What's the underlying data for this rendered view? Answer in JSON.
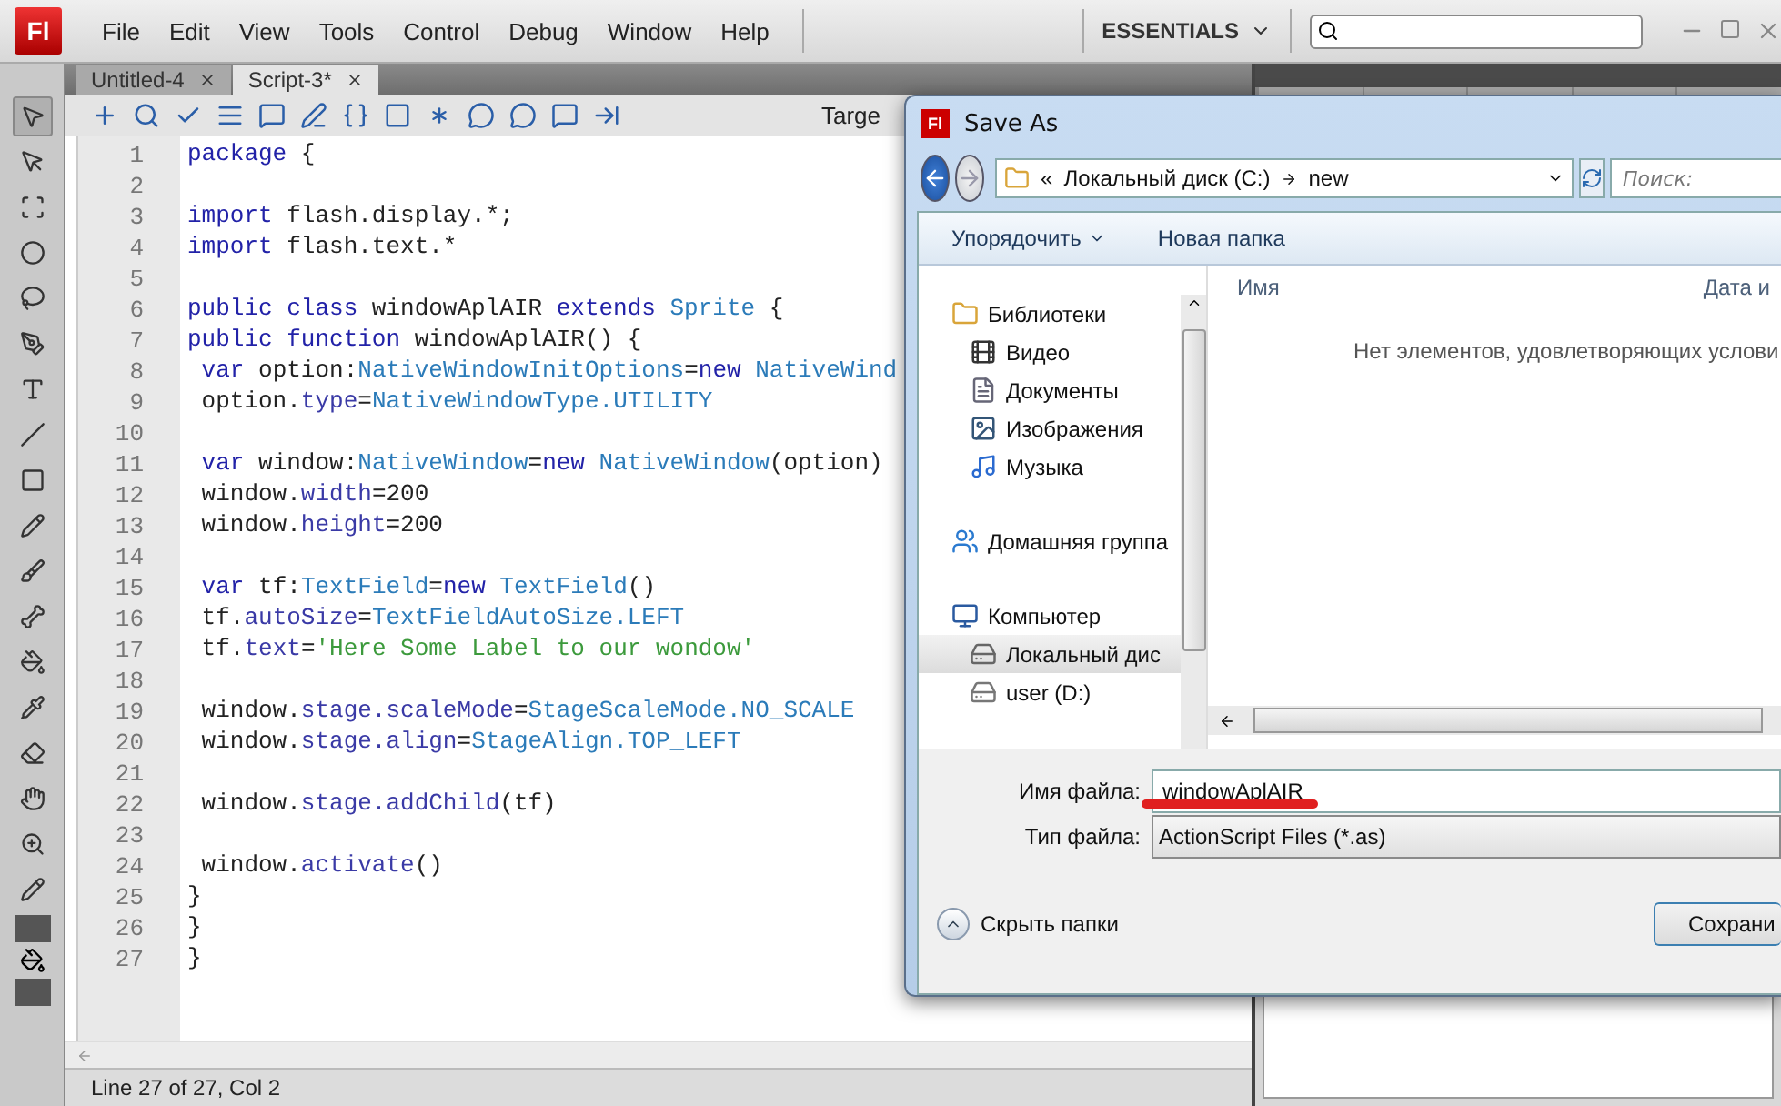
{
  "app": {
    "logo": "Fl",
    "menu": [
      "File",
      "Edit",
      "View",
      "Tools",
      "Control",
      "Debug",
      "Window",
      "Help"
    ],
    "workspace": "ESSENTIALS"
  },
  "tabs": [
    {
      "label": "Untitled-4",
      "selected": false
    },
    {
      "label": "Script-3*",
      "selected": true
    }
  ],
  "editor": {
    "target_label": "Targe",
    "lines": [
      {
        "number": "1",
        "tokens": [
          {
            "t": "package",
            "kind": "keyword"
          },
          {
            "t": " {",
            "kind": "plain"
          }
        ]
      },
      {
        "number": "2"
      },
      {
        "number": "3",
        "tokens": [
          {
            "t": "import",
            "kind": "keyword"
          },
          {
            "t": " flash.display.*;",
            "kind": "plain"
          }
        ]
      },
      {
        "number": "4",
        "tokens": [
          {
            "t": "import",
            "kind": "keyword"
          },
          {
            "t": " flash.text.*",
            "kind": "plain"
          }
        ]
      },
      {
        "number": "5"
      },
      {
        "number": "6",
        "tokens": [
          {
            "t": "public class",
            "kind": "keyword"
          },
          {
            "t": " windowAplAIR ",
            "kind": "plain"
          },
          {
            "t": "extends",
            "kind": "keyword"
          },
          {
            "t": " Sprite",
            "kind": "type"
          },
          {
            "t": " {",
            "kind": "plain"
          }
        ]
      },
      {
        "number": "7",
        "tokens": [
          {
            "t": "public function",
            "kind": "keyword"
          },
          {
            "t": " windowAplAIR() {",
            "kind": "plain"
          }
        ]
      },
      {
        "number": "8",
        "tokens": [
          {
            "t": " var",
            "kind": "keyword"
          },
          {
            "t": " option:",
            "kind": "plain"
          },
          {
            "t": "NativeWindowInitOptions",
            "kind": "type"
          },
          {
            "t": "=",
            "kind": "plain"
          },
          {
            "t": "new",
            "kind": "keyword"
          },
          {
            "t": " NativeWind",
            "kind": "type"
          }
        ]
      },
      {
        "number": "9",
        "tokens": [
          {
            "t": " option.",
            "kind": "plain"
          },
          {
            "t": "type",
            "kind": "property"
          },
          {
            "t": "=",
            "kind": "plain"
          },
          {
            "t": "NativeWindowType.UTILITY",
            "kind": "type"
          }
        ]
      },
      {
        "number": "10"
      },
      {
        "number": "11",
        "tokens": [
          {
            "t": " var",
            "kind": "keyword"
          },
          {
            "t": " window:",
            "kind": "plain"
          },
          {
            "t": "NativeWindow",
            "kind": "type"
          },
          {
            "t": "=",
            "kind": "plain"
          },
          {
            "t": "new",
            "kind": "keyword"
          },
          {
            "t": " NativeWindow",
            "kind": "type"
          },
          {
            "t": "(option)",
            "kind": "plain"
          }
        ]
      },
      {
        "number": "12",
        "tokens": [
          {
            "t": " window.",
            "kind": "plain"
          },
          {
            "t": "width",
            "kind": "property"
          },
          {
            "t": "=200",
            "kind": "plain"
          }
        ]
      },
      {
        "number": "13",
        "tokens": [
          {
            "t": " window.",
            "kind": "plain"
          },
          {
            "t": "height",
            "kind": "property"
          },
          {
            "t": "=200",
            "kind": "plain"
          }
        ]
      },
      {
        "number": "14"
      },
      {
        "number": "15",
        "tokens": [
          {
            "t": " var",
            "kind": "keyword"
          },
          {
            "t": " tf:",
            "kind": "plain"
          },
          {
            "t": "TextField",
            "kind": "type"
          },
          {
            "t": "=",
            "kind": "plain"
          },
          {
            "t": "new",
            "kind": "keyword"
          },
          {
            "t": " TextField",
            "kind": "type"
          },
          {
            "t": "()",
            "kind": "plain"
          }
        ]
      },
      {
        "number": "16",
        "tokens": [
          {
            "t": " tf.",
            "kind": "plain"
          },
          {
            "t": "autoSize",
            "kind": "property"
          },
          {
            "t": "=",
            "kind": "plain"
          },
          {
            "t": "TextFieldAutoSize.LEFT",
            "kind": "type"
          }
        ]
      },
      {
        "number": "17",
        "tokens": [
          {
            "t": " tf.",
            "kind": "plain"
          },
          {
            "t": "text",
            "kind": "property"
          },
          {
            "t": "=",
            "kind": "plain"
          },
          {
            "t": "'Here Some Label to our wondow'",
            "kind": "string"
          }
        ]
      },
      {
        "number": "18"
      },
      {
        "number": "19",
        "tokens": [
          {
            "t": " window.",
            "kind": "plain"
          },
          {
            "t": "stage.scaleMode",
            "kind": "property"
          },
          {
            "t": "=",
            "kind": "plain"
          },
          {
            "t": "StageScaleMode.NO_SCALE",
            "kind": "type"
          }
        ]
      },
      {
        "number": "20",
        "tokens": [
          {
            "t": " window.",
            "kind": "plain"
          },
          {
            "t": "stage.align",
            "kind": "property"
          },
          {
            "t": "=",
            "kind": "plain"
          },
          {
            "t": "StageAlign.TOP_LEFT",
            "kind": "type"
          }
        ]
      },
      {
        "number": "21"
      },
      {
        "number": "22",
        "tokens": [
          {
            "t": " window.",
            "kind": "plain"
          },
          {
            "t": "stage.addChild",
            "kind": "property"
          },
          {
            "t": "(tf)",
            "kind": "plain"
          }
        ]
      },
      {
        "number": "23"
      },
      {
        "number": "24",
        "tokens": [
          {
            "t": " window.",
            "kind": "plain"
          },
          {
            "t": "activate",
            "kind": "property"
          },
          {
            "t": "()",
            "kind": "plain"
          }
        ]
      },
      {
        "number": "25",
        "tokens": [
          {
            "t": "}",
            "kind": "plain"
          }
        ]
      },
      {
        "number": "26",
        "tokens": [
          {
            "t": "}",
            "kind": "plain"
          }
        ]
      },
      {
        "number": "27",
        "tokens": [
          {
            "t": "}",
            "kind": "plain"
          }
        ]
      }
    ]
  },
  "status_bar": "Line 27 of 27, Col 2",
  "dialog": {
    "logo": "Fl",
    "title": "Save As",
    "address": {
      "overflow": "«",
      "segments": [
        "Локальный диск (C:)",
        "new"
      ],
      "search_placeholder": "Поиск:"
    },
    "commands": [
      {
        "label": "Упорядочить",
        "dropdown": true
      },
      {
        "label": "Новая папка",
        "dropdown": false
      }
    ],
    "nav": [
      {
        "label": "Библиотеки",
        "kind": "library",
        "selected": false,
        "children": [
          {
            "label": "Видео",
            "kind": "video",
            "selected": false
          },
          {
            "label": "Документы",
            "kind": "document",
            "selected": false
          },
          {
            "label": "Изображения",
            "kind": "image",
            "selected": false
          },
          {
            "label": "Музыка",
            "kind": "music",
            "selected": false
          }
        ]
      },
      {
        "label": "Домашняя группа",
        "kind": "homegroup",
        "selected": false
      },
      {
        "label": "Компьютер",
        "kind": "computer",
        "selected": false,
        "children": [
          {
            "label": "Локальный дис",
            "kind": "drive",
            "selected": true
          },
          {
            "label": "user (D:)",
            "kind": "drive2",
            "selected": false
          }
        ]
      }
    ],
    "columns": [
      "Имя",
      "Дата и"
    ],
    "empty_message": "Нет элементов, удовлетворяющих услови",
    "filename_label": "Имя файла:",
    "filename": "windowAplAIR",
    "filetype_label": "Тип файла:",
    "filetype": "ActionScript Files (*.as)",
    "hide_folders": "Скрыть папки",
    "save_button": "Сохрани"
  }
}
